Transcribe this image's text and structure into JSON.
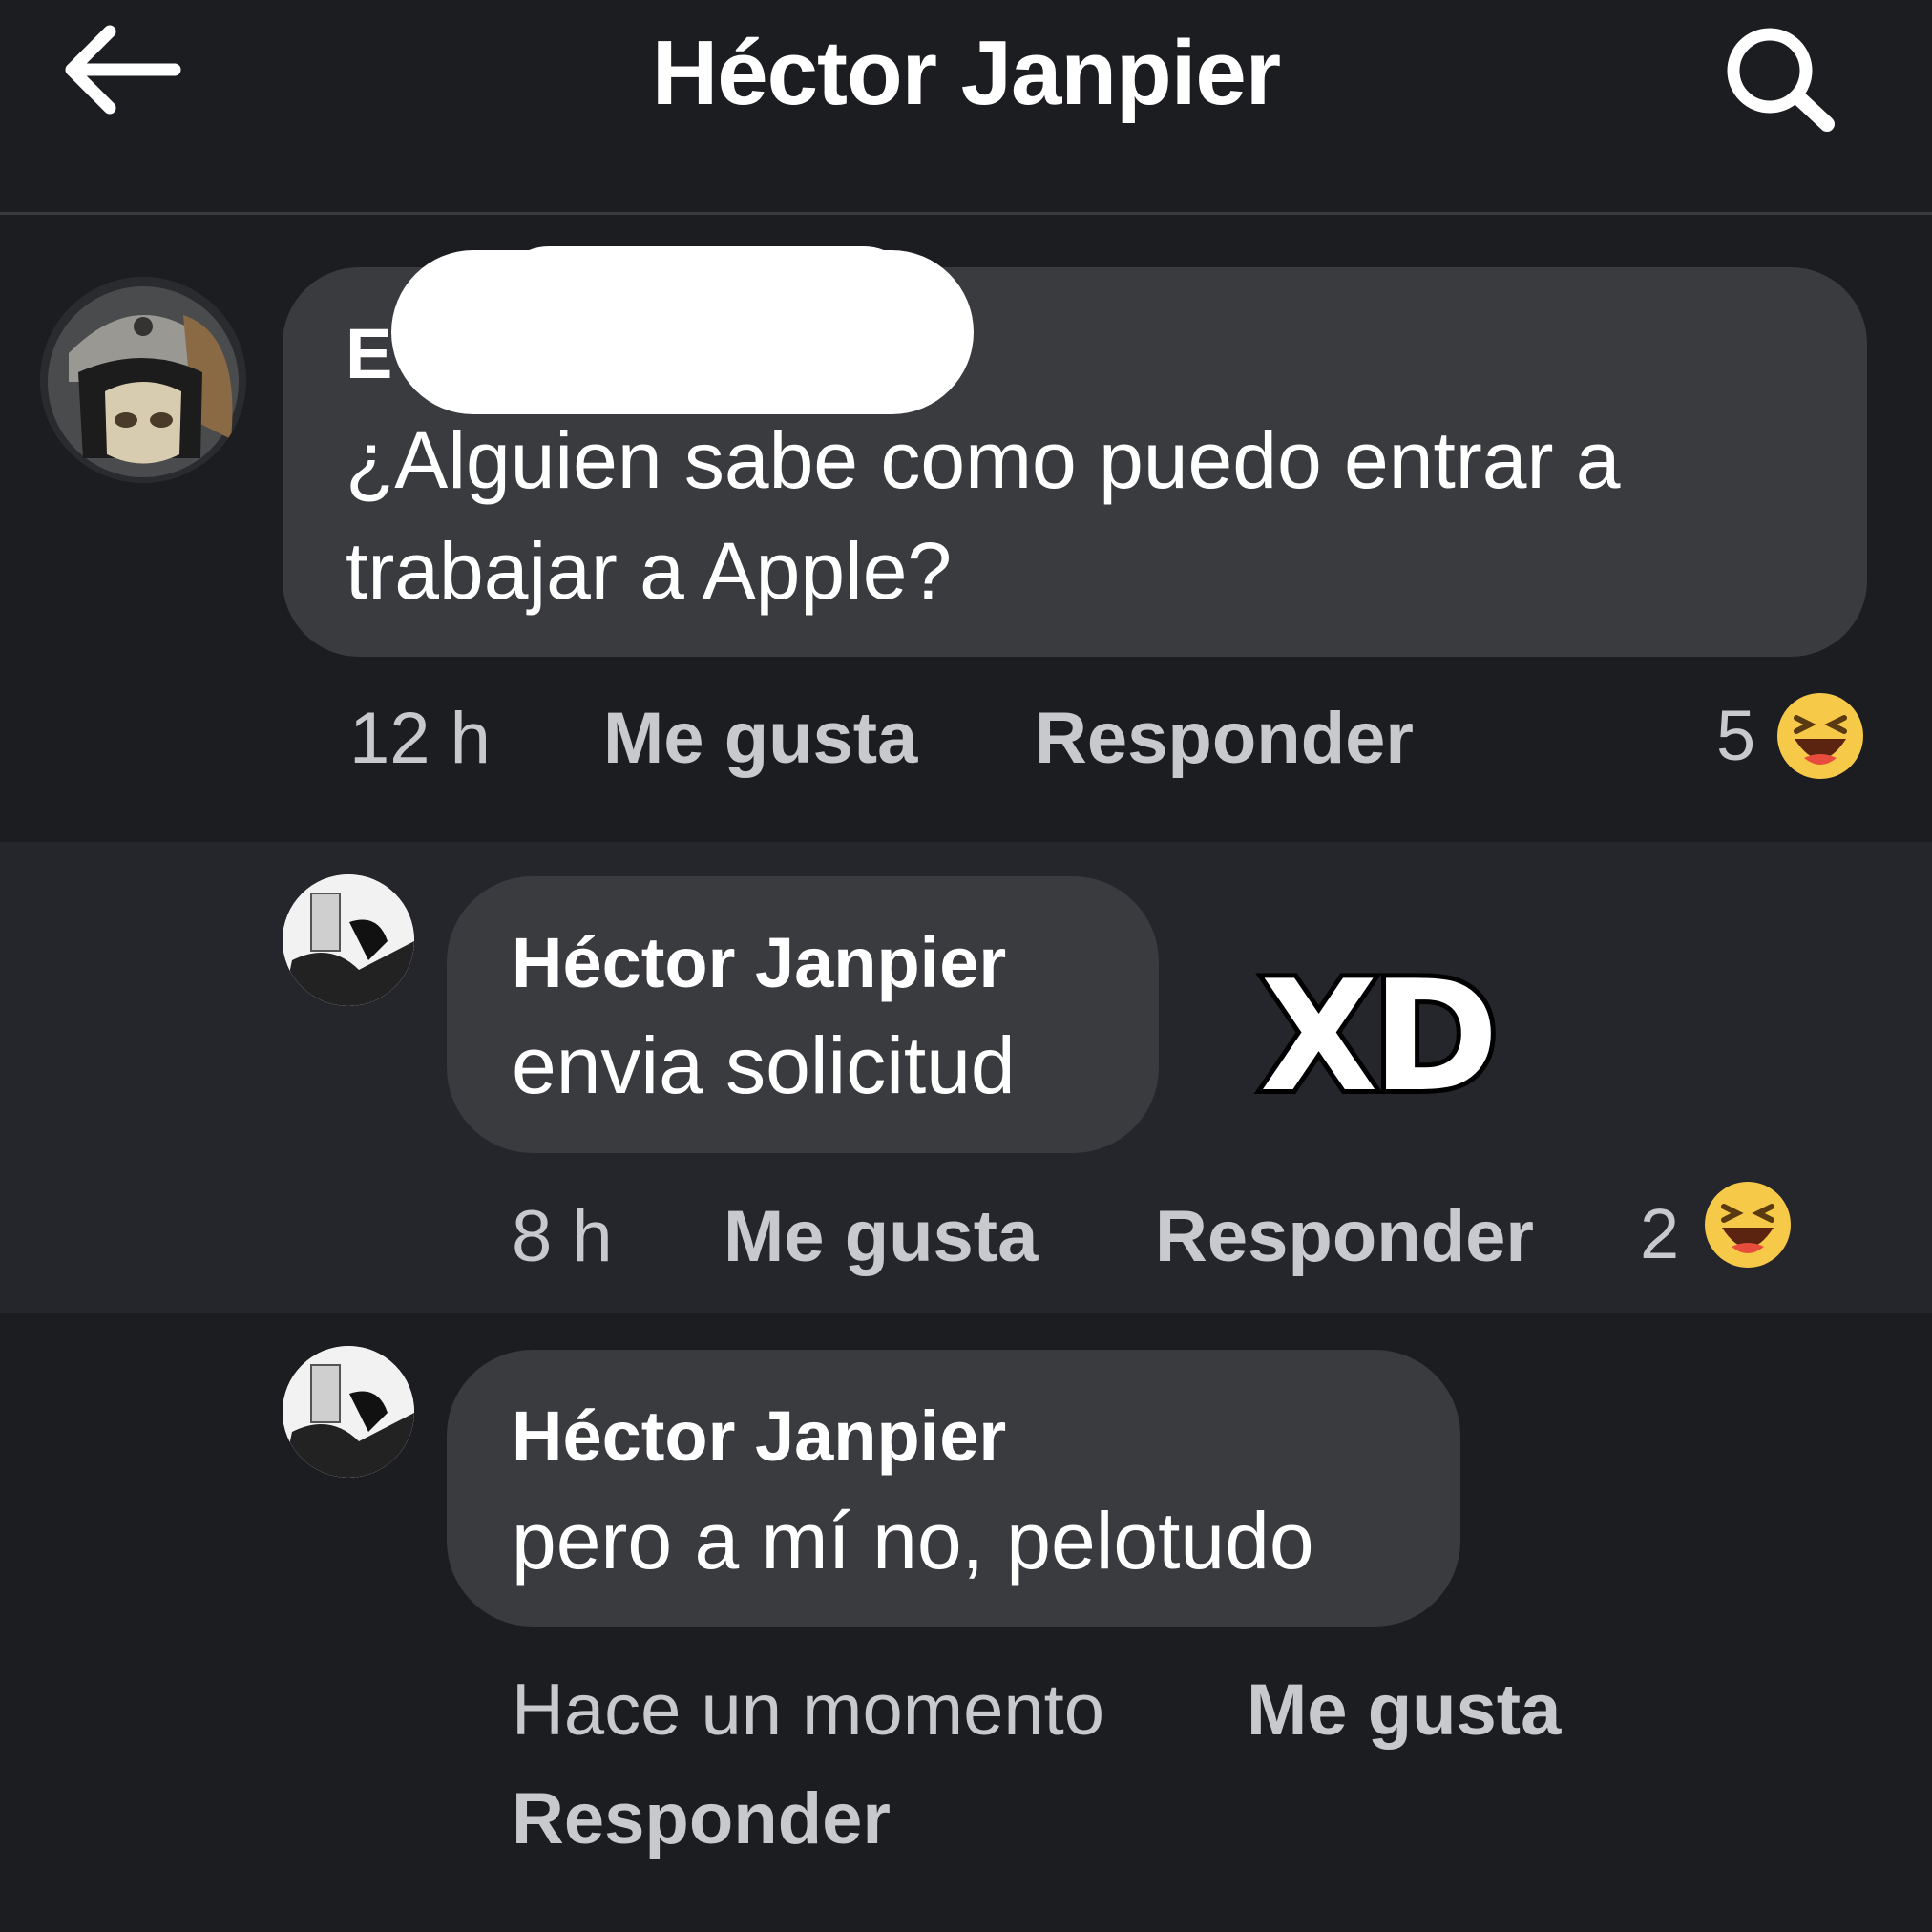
{
  "header": {
    "title": "Héctor Janpier",
    "back_icon": "arrow-left-icon",
    "search_icon": "search-icon"
  },
  "comments": [
    {
      "author": "E",
      "author_redacted": true,
      "text_lines": [
        "¿Alguien sabe como puedo entrar a",
        "trabajar a Apple?"
      ],
      "time": "12 h",
      "like_label": "Me gusta",
      "reply_label": "Responder",
      "reaction_count": "5",
      "reaction_icon": "laughing-emoji-icon"
    },
    {
      "author": "Héctor Janpier",
      "text_lines": [
        "envia solicitud"
      ],
      "time": "8 h",
      "like_label": "Me gusta",
      "reply_label": "Responder",
      "reaction_count": "2",
      "reaction_icon": "laughing-emoji-icon"
    },
    {
      "author": "Héctor Janpier",
      "text_lines": [
        "pero a mí no, pelotudo"
      ],
      "time": "Hace un momento",
      "like_label": "Me gusta",
      "reply_label": "Responder"
    }
  ],
  "overlay_text": "XD",
  "colors": {
    "background": "#1c1d21",
    "bubble": "#3a3b3f",
    "highlight_band": "#25262b",
    "reaction_yellow": "#f7c948"
  }
}
